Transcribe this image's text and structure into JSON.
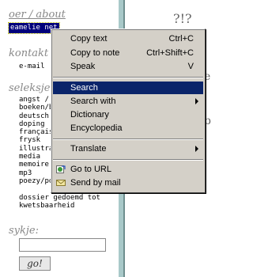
{
  "sidebar": {
    "about_heading": "oer / about",
    "about_selected": "eamelie net",
    "contact_heading": "kontakt",
    "email_label": "e-mail",
    "selections_heading": "seleksje",
    "selections": [
      "angst / fe",
      "boeken/b",
      "deutsch",
      "doping",
      "français",
      "frysk",
      "illustraas",
      "media",
      "memoire",
      "mp3",
      "poezy/po"
    ],
    "tail_line1": "dossier gedoemd tot",
    "tail_line2": "kwetsbaarheid",
    "search_heading": "sykje:",
    "search_value": "",
    "go_label": "go!"
  },
  "right": {
    "title": "?!?",
    "mark_e": "e",
    "mark_b": "b"
  },
  "context_menu": {
    "items": [
      {
        "label": "Copy text",
        "shortcut": "Ctrl+C"
      },
      {
        "label": "Copy to note",
        "shortcut": "Ctrl+Shift+C"
      },
      {
        "label": "Speak",
        "shortcut": "V"
      },
      {
        "label": "Search",
        "shortcut": ""
      },
      {
        "label": "Search with",
        "shortcut": ""
      },
      {
        "label": "Dictionary",
        "shortcut": ""
      },
      {
        "label": "Encyclopedia",
        "shortcut": ""
      },
      {
        "label": "Translate",
        "shortcut": ""
      },
      {
        "label": "Go to URL",
        "shortcut": ""
      },
      {
        "label": "Send by mail",
        "shortcut": ""
      }
    ]
  },
  "colors": {
    "menu_bg": "#d4d0c8",
    "menu_highlight": "#0a246a",
    "selection_bg": "#00007b"
  }
}
